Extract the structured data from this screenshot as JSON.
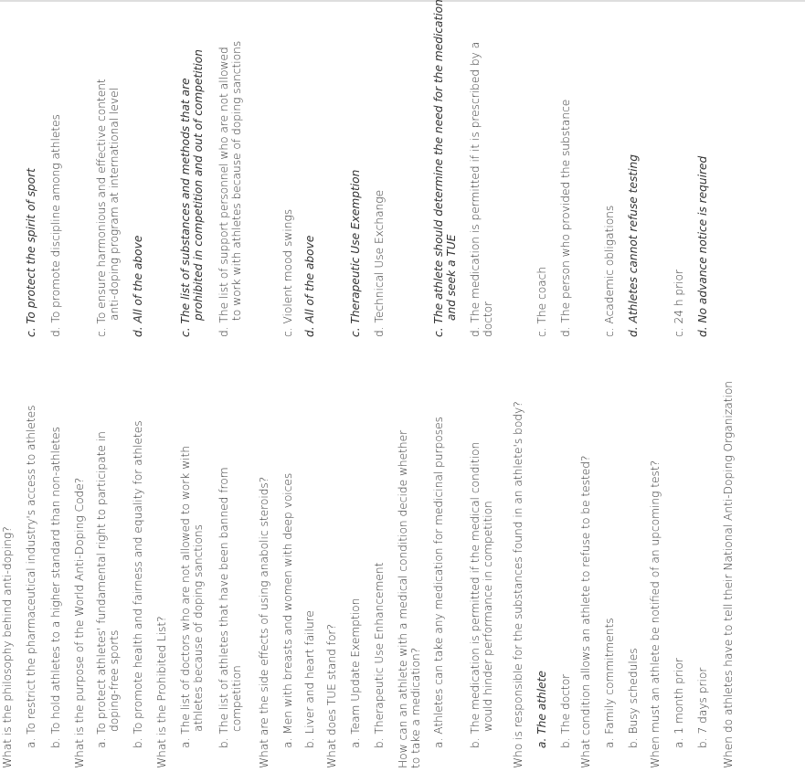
{
  "quiz": [
    {
      "question": "What is the philosophy behind anti-doping?",
      "answers": [
        [
          "a. To restrict the pharmaceutical industry's access to athletes"
        ],
        [
          "b. To hold athletes to a higher standard than non-athletes"
        ],
        [
          "c. To protect the spirit of sport"
        ],
        [
          "d. To promote discipline among athletes"
        ]
      ]
    },
    {
      "question": "What is the purpose of the World Anti-Doping Code?",
      "answers": [
        [
          "a. To protect athletes' fundamental right to participate in",
          "doping-free sports"
        ],
        [
          "b. To promote health and fairness and equality for athletes"
        ],
        [
          "c. To ensure harmonious and effective content",
          "anti-doping program at international level"
        ],
        [
          "d. All of the above"
        ]
      ]
    },
    {
      "question": "What is the Prohibited List?",
      "answers": [
        [
          "a. The list of doctors who are not allowed to work with",
          "athletes because of doping sanctions"
        ],
        [
          "b. The list of athletes that have been banned from",
          "competition"
        ],
        [
          "c. The list of substances and methods that are",
          "prohibited in competition and out of competition"
        ],
        [
          "d. The list of support personnel who are not allowed",
          "to work with athletes because of doping sanctions"
        ]
      ]
    },
    {
      "question": "What are the side effects of using anabolic steroids?",
      "answers": [
        [
          "a. Men with breasts and women with deep voices"
        ],
        [
          "b. Liver and heart failure"
        ],
        [
          "c. Violent mood swings"
        ],
        [
          "d. All of the above"
        ]
      ]
    },
    {
      "question": "What does TUE stand for?",
      "answers": [
        [
          "a. Team Update Exemption"
        ],
        [
          "b. Therapeutic Use Enhancement"
        ],
        [
          "c. Therapeutic Use Exemption"
        ],
        [
          "d. Technical Use Exchange"
        ]
      ]
    },
    {
      "question": [
        "How can an athlete with a medical condition decide whether",
        "to take a medication?"
      ],
      "answers": [
        [
          "a. Athletes can take any medication for medicinal purposes"
        ],
        [
          "b. The medication is permitted if the medical condition",
          "would hinder performance in competition"
        ],
        [
          "c. The athlete should determine the need for the medication",
          "and seek a TUE"
        ],
        [
          "d. The medication is permitted if it is prescribed by a",
          "doctor"
        ]
      ]
    },
    {
      "question": "Who is responsible for the substances found in an athlete's body?",
      "answers": [
        [
          "a. The athlete"
        ],
        [
          "b. The doctor"
        ],
        [
          "c. The coach"
        ],
        [
          "d. The person who provided the substance"
        ]
      ]
    },
    {
      "question": "What condition allows an athlete to refuse to be tested?",
      "answers": [
        [
          "a. Family commitments"
        ],
        [
          "b. Busy schedules"
        ],
        [
          "c. Academic obligations"
        ],
        [
          "d. Athletes cannot refuse testing"
        ]
      ]
    },
    {
      "question": "When must an athlete be notified of an upcoming test?",
      "answers": [
        [
          "a. 1 month prior"
        ],
        [
          "b. 7 days prior"
        ],
        [
          "c. 24 h prior"
        ],
        [
          "d. No advance notice is required"
        ]
      ]
    },
    {
      "question": "When do athletes have to tell their National Anti-Doping Organization",
      "answers": []
    }
  ]
}
